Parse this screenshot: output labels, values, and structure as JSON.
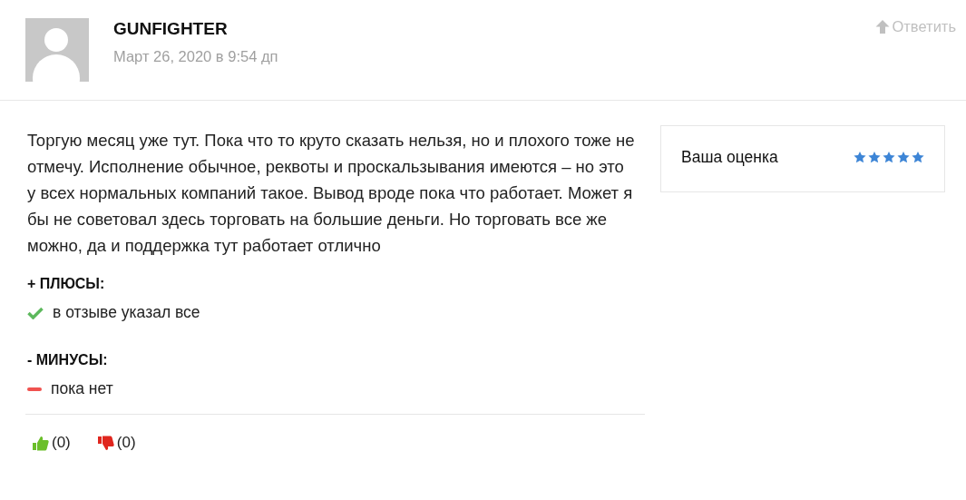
{
  "author": {
    "name": "GUNFIGHTER",
    "date": "Март 26, 2020 в 9:54 дп"
  },
  "reply": {
    "label": "Ответить"
  },
  "review": {
    "text": "Торгую месяц уже тут. Пока что то круто сказать нельзя, но и плохого тоже не отмечу. Исполнение обычное, реквоты и проскальзывания имеются – но это у всех нормальных компаний такое. Вывод вроде пока что работает. Может я бы не советовал здесь торговать на большие деньги. Но торговать все же можно, да и поддержка тут работает отлично"
  },
  "rating": {
    "label": "Ваша оценка",
    "stars": 5
  },
  "sections": [
    {
      "kind": "pros",
      "title": "+ ПЛЮСЫ:",
      "items": [
        "в отзыве указал все"
      ]
    },
    {
      "kind": "cons",
      "title": "- МИНУСЫ:",
      "items": [
        "пока нет"
      ]
    }
  ],
  "votes": [
    {
      "kind": "up",
      "count": "(0)"
    },
    {
      "kind": "down",
      "count": "(0)"
    }
  ]
}
